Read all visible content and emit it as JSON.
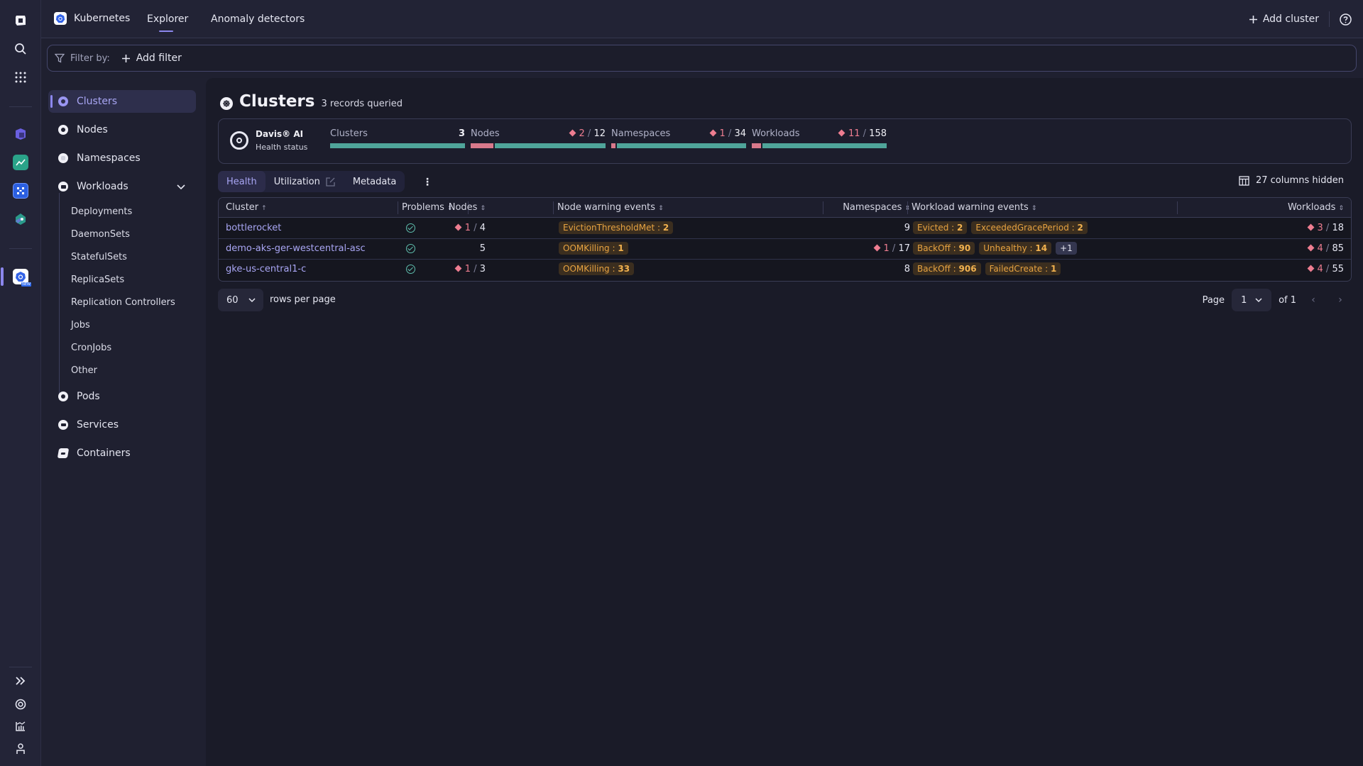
{
  "app": {
    "name": "Kubernetes",
    "tabs": [
      {
        "label": "Explorer",
        "active": true
      },
      {
        "label": "Anomaly detectors",
        "active": false
      }
    ],
    "add_cluster_label": "Add cluster",
    "new_badge": "NEW"
  },
  "rail": {
    "top_icons": [
      "dynatrace-logo-icon",
      "search-icon",
      "apps-grid-icon"
    ],
    "app_icons": [
      "infrastructure-app-icon",
      "dashboards-app-icon",
      "workflows-app-icon",
      "hub-app-icon"
    ],
    "active_app_icon": "kubernetes-app-icon",
    "bottom_icons": [
      "expand-icon",
      "help-lifebuoy-icon",
      "whats-new-icon",
      "user-icon"
    ]
  },
  "filter": {
    "label": "Filter by:",
    "add_label": "Add filter"
  },
  "sidebar": {
    "items": [
      {
        "label": "Clusters",
        "active": true
      },
      {
        "label": "Nodes"
      },
      {
        "label": "Namespaces"
      },
      {
        "label": "Workloads",
        "expanded": true
      }
    ],
    "workload_children": [
      "Deployments",
      "DaemonSets",
      "StatefulSets",
      "ReplicaSets",
      "Replication Controllers",
      "Jobs",
      "CronJobs",
      "Other"
    ],
    "after_items": [
      {
        "label": "Pods"
      },
      {
        "label": "Services"
      },
      {
        "label": "Containers"
      }
    ]
  },
  "page": {
    "title": "Clusters",
    "records": "3 records queried"
  },
  "health": {
    "davis_name": "Davis® AI",
    "davis_sub": "Health status",
    "blocks": [
      {
        "label": "Clusters",
        "bad": null,
        "total": "3",
        "bad_fraction": 0
      },
      {
        "label": "Nodes",
        "bad": "2",
        "total": "12",
        "bad_fraction": 0.167
      },
      {
        "label": "Namespaces",
        "bad": "1",
        "total": "34",
        "bad_fraction": 0.029
      },
      {
        "label": "Workloads",
        "bad": "11",
        "total": "158",
        "bad_fraction": 0.07
      }
    ]
  },
  "subtabs": [
    {
      "label": "Health",
      "active": true
    },
    {
      "label": "Utilization"
    },
    {
      "label": "Metadata"
    }
  ],
  "columns_hidden": "27 columns hidden",
  "table": {
    "headers": {
      "cluster": "Cluster",
      "problems": "Problems",
      "nodes": "Nodes",
      "node_warnings": "Node warning events",
      "namespaces": "Namespaces",
      "workload_warnings": "Workload warning events",
      "workloads": "Workloads"
    },
    "rows": [
      {
        "cluster": "bottlerocket",
        "problems": "ok",
        "nodes_bad": "1",
        "nodes_total": "4",
        "node_events": [
          {
            "name": "EvictionThresholdMet :",
            "count": "2"
          }
        ],
        "namespaces_bad": null,
        "namespaces_total": "9",
        "workload_events": [
          {
            "name": "Evicted :",
            "count": "2"
          },
          {
            "name": "ExceededGracePeriod :",
            "count": "2"
          }
        ],
        "workload_more": null,
        "workloads_bad": "3",
        "workloads_total": "18"
      },
      {
        "cluster": "demo-aks-ger-westcentral-asc",
        "problems": "ok",
        "nodes_bad": null,
        "nodes_total": "5",
        "node_events": [
          {
            "name": "OOMKilling :",
            "count": "1"
          }
        ],
        "namespaces_bad": "1",
        "namespaces_total": "17",
        "workload_events": [
          {
            "name": "BackOff :",
            "count": "90"
          },
          {
            "name": "Unhealthy :",
            "count": "14"
          }
        ],
        "workload_more": "+1",
        "workloads_bad": "4",
        "workloads_total": "85"
      },
      {
        "cluster": "gke-us-central1-c",
        "problems": "ok",
        "nodes_bad": "1",
        "nodes_total": "3",
        "node_events": [
          {
            "name": "OOMKilling :",
            "count": "33"
          }
        ],
        "namespaces_bad": null,
        "namespaces_total": "8",
        "workload_events": [
          {
            "name": "BackOff :",
            "count": "906"
          },
          {
            "name": "FailedCreate :",
            "count": "1"
          }
        ],
        "workload_more": null,
        "workloads_bad": "4",
        "workloads_total": "55"
      }
    ]
  },
  "pagination": {
    "rows_per_page": "60",
    "rows_label": "rows per page",
    "page_label": "Page",
    "page": "1",
    "of_label": "of 1"
  },
  "colors": {
    "accent": "#8c87ee",
    "healthy": "#4fa59a",
    "unhealthy": "#d8798b",
    "warning_text": "#e7a341"
  }
}
